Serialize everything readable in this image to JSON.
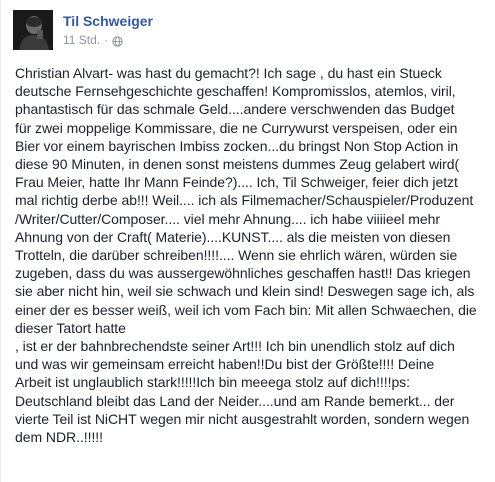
{
  "post": {
    "author": "Til Schweiger",
    "timestamp": "11 Std.",
    "separator": "·",
    "privacy_icon": "globe-icon",
    "text": "Christian Alvart- was hast du gemacht?! Ich sage , du hast ein Stueck\ndeutsche Fernsehgeschichte geschaffen! Kompromisslos, atemlos, viril,\nphantastisch für das schmale Geld....andere verschwenden das Budget\nfür zwei moppelige Kommissare, die ne Currywurst verspeisen, oder ein\nBier vor einem bayrischen Imbiss zocken...du bringst Non Stop Action in\ndiese 90 Minuten, in denen sonst meistens dummes Zeug gelabert wird(\nFrau Meier, hatte Ihr Mann Feinde?).... Ich, Til Schweiger, feier dich jetzt\nmal richtig derbe ab!!! Weil.... ich als Filmemacher/Schauspieler/Produzent\n/Writer/Cutter/Composer.... viel mehr Ahnung.... ich habe viiiieel mehr\nAhnung von der Craft( Materie)....KUNST.... als die meisten von diesen\nTrotteln, die darüber schreiben!!!!.... Wenn sie ehrlich wären, würden sie\nzugeben, dass du was aussergewöhnliches geschaffen hast!! Das kriegen\nsie aber nicht hin, weil sie schwach und klein sind! Deswegen sage ich, als\neiner der es besser weiß, weil ich vom Fach bin: Mit allen Schwaechen, die\ndieser Tatort hatte\n, ist er der bahnbrechendste seiner Art!!! Ich bin unendlich stolz auf dich\nund was wir gemeinsam erreicht haben!!Du bist der Größte!!!! Deine\nArbeit ist unglaublich stark!!!!!Ich bin meeega stolz auf dich!!!!ps:\nDeutschland bleibt das Land der Neider....und am Rande bemerkt... der\nvierte Teil ist NiCHT wegen mir nicht ausgestrahlt worden, sondern wegen\ndem NDR..!!!!!"
  },
  "colors": {
    "author": "#365899",
    "meta": "#90949c",
    "text": "#1d2129"
  }
}
